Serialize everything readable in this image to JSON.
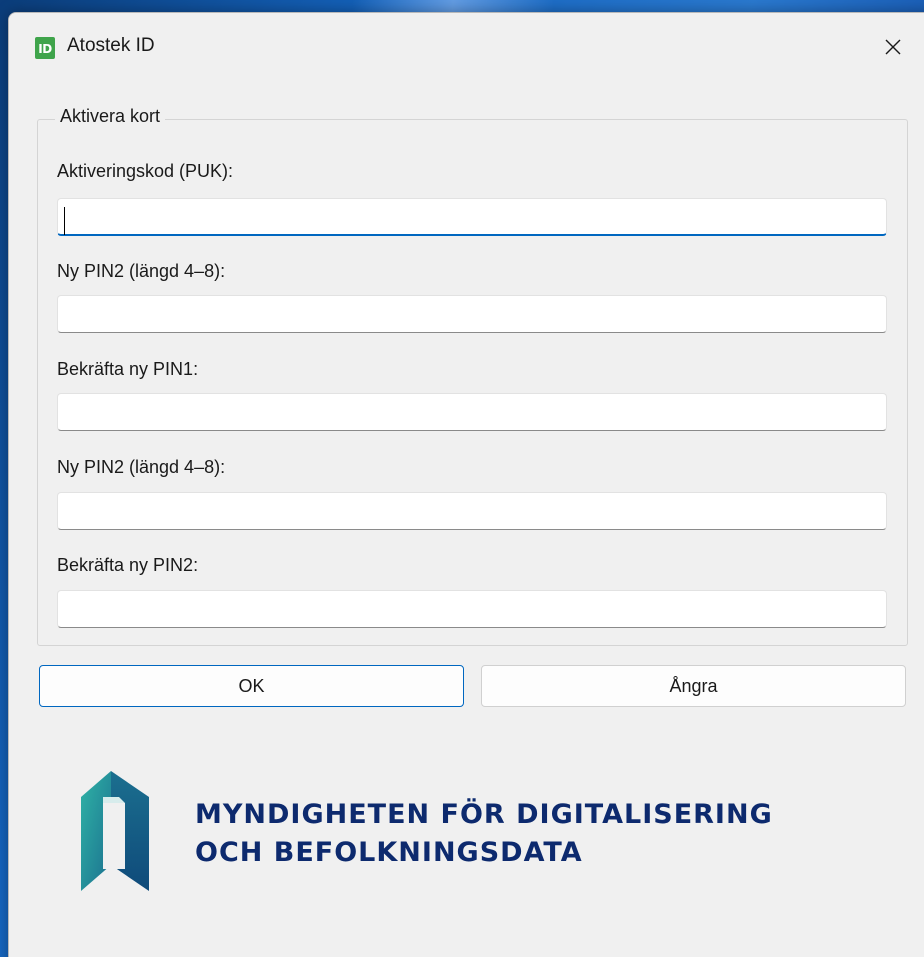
{
  "window": {
    "title": "Atostek ID",
    "app_icon_text": "ID",
    "close_icon": "close-icon"
  },
  "group": {
    "title": "Aktivera kort"
  },
  "fields": [
    {
      "label": "Aktiveringskod (PUK):",
      "value": ""
    },
    {
      "label": "Ny PIN2 (längd 4–8):",
      "value": ""
    },
    {
      "label": "Bekräfta ny PIN1:",
      "value": ""
    },
    {
      "label": "Ny PIN2 (längd 4–8):",
      "value": ""
    },
    {
      "label": "Bekräfta ny PIN2:",
      "value": ""
    }
  ],
  "buttons": {
    "ok_label": "OK",
    "cancel_label": "Ångra"
  },
  "organization": {
    "line1": "MYNDIGHETEN FÖR DIGITALISERING",
    "line2": "OCH BEFOLKNINGSDATA",
    "text_color": "#0d2a6e",
    "logo_colors": [
      "#2fb3a6",
      "#1b6f8f",
      "#0f4a7a"
    ]
  },
  "colors": {
    "accent": "#0067c0",
    "app_icon": "#3fa44b",
    "window_bg": "#f0f0f0"
  }
}
